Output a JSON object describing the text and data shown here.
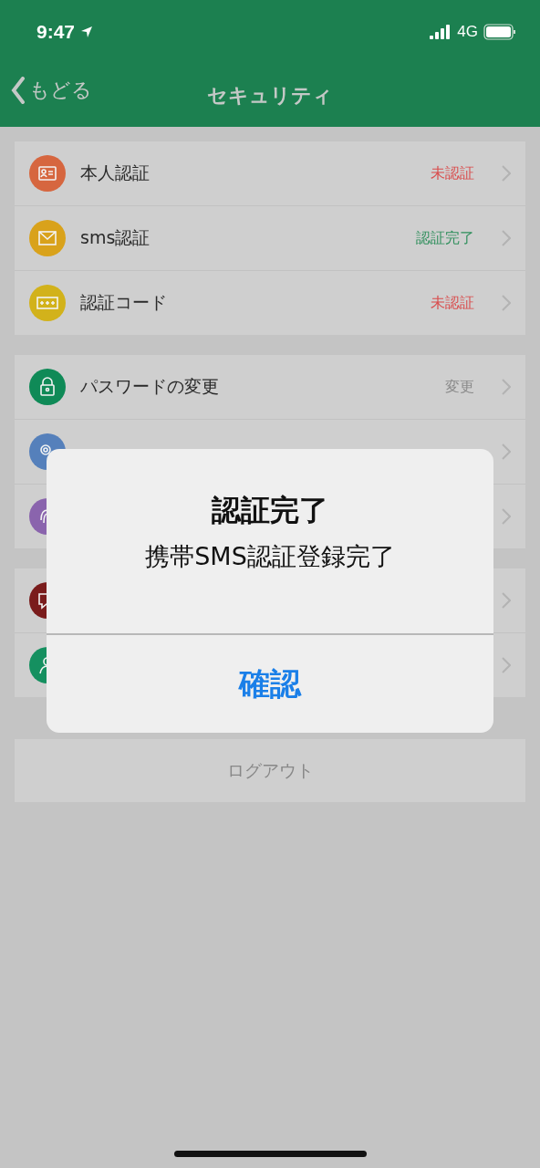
{
  "status_bar": {
    "time": "9:47",
    "network": "4G"
  },
  "nav": {
    "back_label": "もどる",
    "title": "セキュリティ"
  },
  "groups": [
    {
      "items": [
        {
          "kind": "id-card",
          "color": "#d6663f",
          "label": "本人認証",
          "status": {
            "text": "未認証",
            "color": "#d94c4c"
          }
        },
        {
          "kind": "envelope",
          "color": "#d9a21b",
          "label": "sms認証",
          "status": {
            "text": "認証完了",
            "color": "#2f8f5c"
          }
        },
        {
          "kind": "code",
          "color": "#d2b21b",
          "label": "認証コード",
          "status": {
            "text": "未認証",
            "color": "#d94c4c"
          }
        }
      ]
    },
    {
      "items": [
        {
          "kind": "lock",
          "color": "#0f8a57",
          "label": "パスワードの変更",
          "status": {
            "text": "変更",
            "color": "#8a8a8a"
          }
        },
        {
          "kind": "key",
          "color": "#5580bb"
        },
        {
          "kind": "fingerprint",
          "color": "#8a64ad"
        }
      ]
    },
    {
      "items": [
        {
          "kind": "chat",
          "color": "#7a1c1c"
        },
        {
          "kind": "person",
          "color": "#159060"
        }
      ]
    }
  ],
  "logout": "ログアウト",
  "dialog": {
    "title": "認証完了",
    "message": "携帯SMS認証登録完了",
    "button": "確認"
  }
}
